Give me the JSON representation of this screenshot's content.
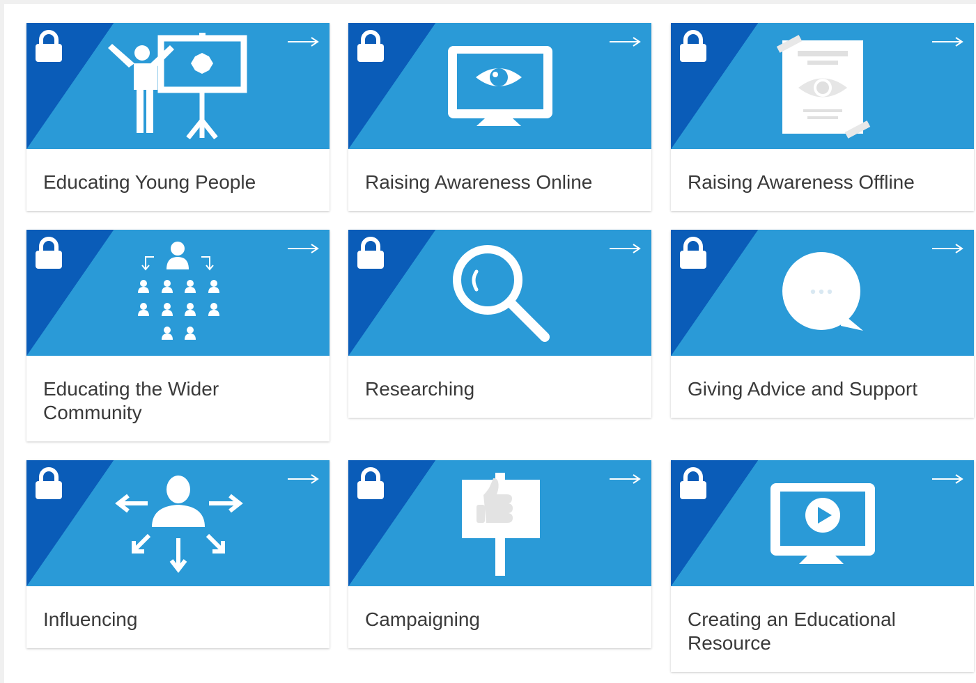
{
  "colors": {
    "banner": "#2a9ad7",
    "corner": "#0a5cb8",
    "label_text": "#3a3a3a",
    "card_bg": "#ffffff"
  },
  "cards": [
    {
      "label": "Educating Young People",
      "icon": "presenter-icon",
      "locked": true
    },
    {
      "label": "Raising Awareness Online",
      "icon": "monitor-eye-icon",
      "locked": true
    },
    {
      "label": "Raising Awareness Offline",
      "icon": "poster-eye-icon",
      "locked": true
    },
    {
      "label": "Educating the Wider Community",
      "icon": "community-icon",
      "locked": true
    },
    {
      "label": "Researching",
      "icon": "magnifier-icon",
      "locked": true
    },
    {
      "label": "Giving Advice and Support",
      "icon": "speech-bubble-icon",
      "locked": true
    },
    {
      "label": "Influencing",
      "icon": "influence-person-icon",
      "locked": true
    },
    {
      "label": "Campaigning",
      "icon": "placard-thumbs-up-icon",
      "locked": true
    },
    {
      "label": "Creating an Educational Resource",
      "icon": "monitor-play-icon",
      "locked": true
    }
  ]
}
